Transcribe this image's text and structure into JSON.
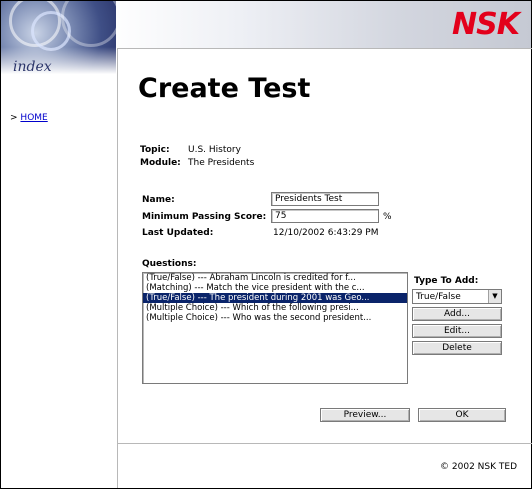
{
  "brand": {
    "logo_text": "NSK"
  },
  "sidebar": {
    "index_label": "index",
    "nav_arrow": ">",
    "home_link": "HOME"
  },
  "page": {
    "title": "Create Test"
  },
  "info": {
    "topic_label": "Topic:",
    "topic_value": "U.S. History",
    "module_label": "Module:",
    "module_value": "The Presidents"
  },
  "form": {
    "name_label": "Name:",
    "name_value": "Presidents Test",
    "min_score_label": "Minimum Passing Score:",
    "min_score_value": "75",
    "min_score_unit": "%",
    "last_updated_label": "Last Updated:",
    "last_updated_value": "12/10/2002 6:43:29 PM"
  },
  "questions": {
    "label": "Questions:",
    "items": [
      "(True/False) --- Abraham Lincoln is credited for f...",
      "(Matching) --- Match the vice president with the c...",
      "(True/False) --- The president during 2001 was Geo...",
      "(Multiple Choice) --- Which of the following presi...",
      "(Multiple Choice) --- Who was the second president..."
    ],
    "selected_index": 2
  },
  "type_to_add": {
    "label": "Type To Add:",
    "selected": "True/False",
    "add_button": "Add...",
    "edit_button": "Edit...",
    "delete_button": "Delete"
  },
  "actions": {
    "preview_button": "Preview...",
    "ok_button": "OK"
  },
  "footer": {
    "copyright": "© 2002 NSK TED"
  },
  "colors": {
    "brand_red": "#e3001b",
    "selection": "#0a246a",
    "link": "#0000cc"
  }
}
